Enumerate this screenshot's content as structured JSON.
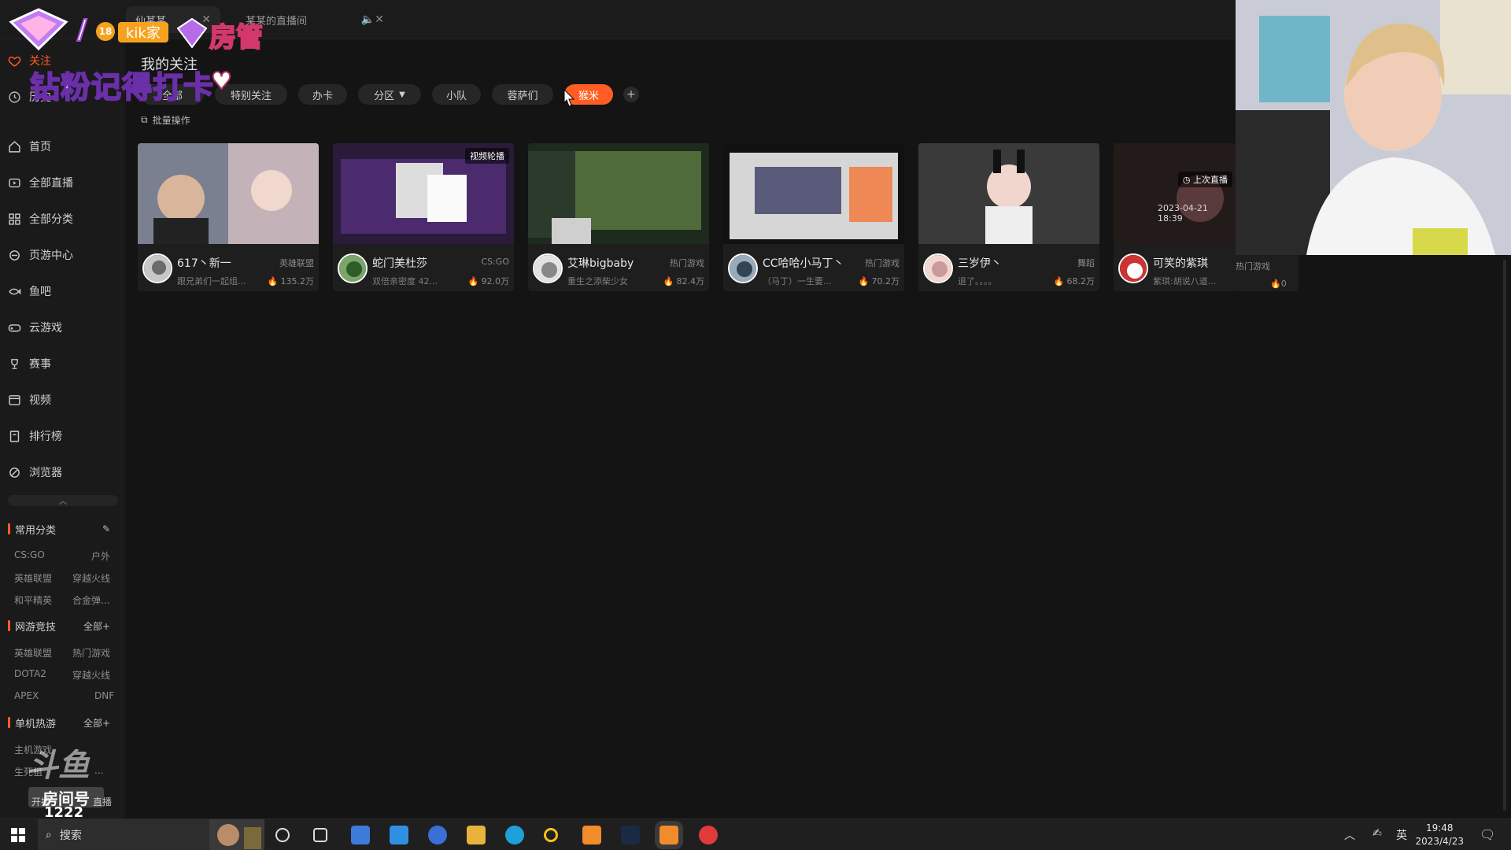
{
  "tabs": [
    {
      "label": "仙某某"
    },
    {
      "label": "某某的直播间"
    }
  ],
  "sidebar": {
    "top": [
      {
        "label": "关注",
        "icon": "heart-icon",
        "active": true
      },
      {
        "label": "历史",
        "icon": "clock-icon"
      }
    ],
    "nav": [
      {
        "label": "首页",
        "icon": "home-icon"
      },
      {
        "label": "全部直播",
        "icon": "live-icon"
      },
      {
        "label": "全部分类",
        "icon": "grid-icon"
      },
      {
        "label": "页游中心",
        "icon": "web-game-icon"
      },
      {
        "label": "鱼吧",
        "icon": "fish-icon"
      },
      {
        "label": "云游戏",
        "icon": "gamepad-icon"
      },
      {
        "label": "赛事",
        "icon": "trophy-icon"
      },
      {
        "label": "视频",
        "icon": "video-icon"
      },
      {
        "label": "排行榜",
        "icon": "rank-icon"
      },
      {
        "label": "浏览器",
        "icon": "browser-icon"
      }
    ],
    "sections": [
      {
        "title": "常用分类",
        "right": "",
        "items": [
          "CS:GO",
          "户外",
          "英雄联盟",
          "穿越火线",
          "和平精英",
          "合金弹..."
        ]
      },
      {
        "title": "网游竞技",
        "right": "全部+",
        "items": [
          "英雄联盟",
          "热门游戏",
          "DOTA2",
          "穿越火线",
          "APEX",
          "DNF"
        ]
      },
      {
        "title": "单机热游",
        "right": "全部+",
        "items": [
          "主机游戏",
          "",
          "生死狙",
          "..."
        ]
      }
    ],
    "bottom": [
      {
        "label": "开播"
      },
      {
        "label": "直播"
      }
    ]
  },
  "main": {
    "title": "我的关注",
    "filters": [
      "全部",
      "特别关注",
      "办卡",
      "分区",
      "小队",
      "蓉萨们",
      "猴米"
    ],
    "active_filter": "猴米",
    "batch_label": "批量操作",
    "cards": [
      {
        "name": "617丶新一",
        "category": "英雄联盟",
        "desc": "跟兄弟们一起组...",
        "popularity": "135.2万",
        "badge": ""
      },
      {
        "name": "蛇门美杜莎",
        "category": "CS:GO",
        "desc": "双倍亲密度 42...",
        "popularity": "92.0万",
        "badge": "视频轮播"
      },
      {
        "name": "艾琳bigbaby",
        "category": "热门游戏",
        "desc": "重生之添柴少女",
        "popularity": "82.4万",
        "badge": ""
      },
      {
        "name": "CC哈哈小马丁丶",
        "category": "热门游戏",
        "desc": "（马丁）一生要...",
        "popularity": "70.2万",
        "badge": ""
      },
      {
        "name": "三岁伊丶",
        "category": "舞蹈",
        "desc": "退了。。。。",
        "popularity": "68.2万",
        "badge": ""
      },
      {
        "name": "可笑的紫琪",
        "category": "热门游戏",
        "desc": "紫琪:胡说八道...",
        "popularity": "0",
        "badge": "上次直播",
        "time": "2023-04-21 18:39"
      }
    ]
  },
  "overlay": {
    "badge_level": "18",
    "badge_name": "kik家",
    "title": "房管",
    "subtitle": "钻粉记得打卡",
    "logo_text": "斗鱼",
    "room_label": "房间号",
    "room_number": "1222"
  },
  "taskbar": {
    "search_placeholder": "搜索",
    "ime": "英",
    "time": "19:48",
    "date": "2023/4/23"
  },
  "colors": {
    "accent": "#ff5d23",
    "bg": "#141414",
    "sidebar": "#1a1a1a"
  }
}
